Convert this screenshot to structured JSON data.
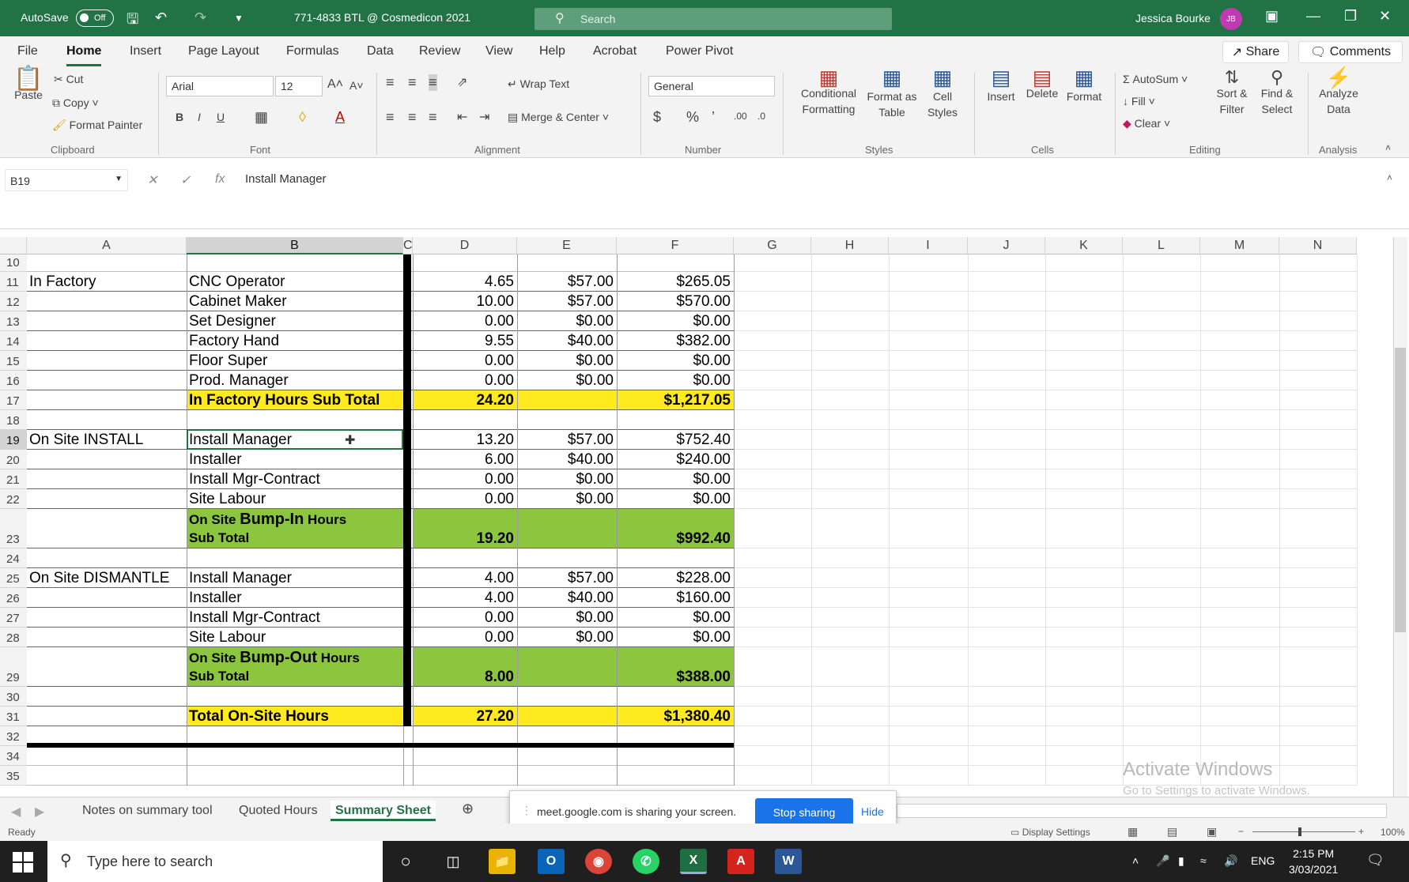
{
  "titlebar": {
    "autosave_label": "AutoSave",
    "autosave_state": "Off",
    "doc_title": "771-4833 BTL @ Cosmedicon 2021",
    "search_placeholder": "Search",
    "user_name": "Jessica Bourke",
    "user_initials": "JB"
  },
  "ribbon_tabs": [
    "File",
    "Home",
    "Insert",
    "Page Layout",
    "Formulas",
    "Data",
    "Review",
    "View",
    "Help",
    "Acrobat",
    "Power Pivot"
  ],
  "share_label": "Share",
  "comments_label": "Comments",
  "ribbon": {
    "clipboard": {
      "paste": "Paste",
      "cut": "Cut",
      "copy": "Copy",
      "format_painter": "Format Painter",
      "label": "Clipboard"
    },
    "font": {
      "family": "Arial",
      "size": "12",
      "label": "Font"
    },
    "alignment": {
      "wrap_text": "Wrap Text",
      "merge_center": "Merge & Center",
      "label": "Alignment"
    },
    "number": {
      "format": "General",
      "label": "Number"
    },
    "styles": {
      "conditional": "Conditional",
      "conditional2": "Formatting",
      "format_as": "Format as",
      "format_as2": "Table",
      "cell": "Cell",
      "cell2": "Styles",
      "label": "Styles"
    },
    "cells": {
      "insert": "Insert",
      "delete": "Delete",
      "format": "Format",
      "label": "Cells"
    },
    "editing": {
      "autosum": "AutoSum",
      "fill": "Fill",
      "clear": "Clear",
      "sort": "Sort &",
      "sort2": "Filter",
      "find": "Find &",
      "find2": "Select",
      "label": "Editing"
    },
    "analysis": {
      "analyze": "Analyze",
      "analyze2": "Data",
      "label": "Analysis"
    }
  },
  "formula_bar": {
    "name_box": "B19",
    "formula": "Install Manager"
  },
  "columns": [
    "A",
    "B",
    "C",
    "D",
    "E",
    "F",
    "G",
    "H",
    "I",
    "J",
    "K",
    "L",
    "M",
    "N"
  ],
  "rows": [
    {
      "num": "10",
      "a": "",
      "b": "",
      "d": "",
      "e": "",
      "f": ""
    },
    {
      "num": "11",
      "a": "In Factory",
      "b": "CNC Operator",
      "d": "4.65",
      "e": "$57.00",
      "f": "$265.05"
    },
    {
      "num": "12",
      "a": "",
      "b": "Cabinet Maker",
      "d": "10.00",
      "e": "$57.00",
      "f": "$570.00"
    },
    {
      "num": "13",
      "a": "",
      "b": "Set Designer",
      "d": "0.00",
      "e": "$0.00",
      "f": "$0.00"
    },
    {
      "num": "14",
      "a": "",
      "b": "Factory Hand",
      "d": "9.55",
      "e": "$40.00",
      "f": "$382.00"
    },
    {
      "num": "15",
      "a": "",
      "b": "Floor Super",
      "d": "0.00",
      "e": "$0.00",
      "f": "$0.00"
    },
    {
      "num": "16",
      "a": "",
      "b": "Prod. Manager",
      "d": "0.00",
      "e": "$0.00",
      "f": "$0.00"
    },
    {
      "num": "17",
      "a": "",
      "b": "In Factory Hours Sub Total",
      "d": "24.20",
      "e": "",
      "f": "$1,217.05"
    },
    {
      "num": "18",
      "a": "",
      "b": "",
      "d": "",
      "e": "",
      "f": ""
    },
    {
      "num": "19",
      "a": "On Site INSTALL",
      "b": "Install Manager",
      "d": "13.20",
      "e": "$57.00",
      "f": "$752.40"
    },
    {
      "num": "20",
      "a": "",
      "b": "Installer",
      "d": "6.00",
      "e": "$40.00",
      "f": "$240.00"
    },
    {
      "num": "21",
      "a": "",
      "b": "Install Mgr-Contract",
      "d": "0.00",
      "e": "$0.00",
      "f": "$0.00"
    },
    {
      "num": "22",
      "a": "",
      "b": "Site Labour",
      "d": "0.00",
      "e": "$0.00",
      "f": "$0.00"
    },
    {
      "num": "23",
      "a": "",
      "b1": "On Site ",
      "b2": "Bump-In",
      "b3": " Hours",
      "b4": "Sub Total",
      "d": "19.20",
      "e": "",
      "f": "$992.40"
    },
    {
      "num": "24",
      "a": "",
      "b": "",
      "d": "",
      "e": "",
      "f": ""
    },
    {
      "num": "25",
      "a": "On Site DISMANTLE",
      "b": "Install Manager",
      "d": "4.00",
      "e": "$57.00",
      "f": "$228.00"
    },
    {
      "num": "26",
      "a": "",
      "b": "Installer",
      "d": "4.00",
      "e": "$40.00",
      "f": "$160.00"
    },
    {
      "num": "27",
      "a": "",
      "b": "Install Mgr-Contract",
      "d": "0.00",
      "e": "$0.00",
      "f": "$0.00"
    },
    {
      "num": "28",
      "a": "",
      "b": "Site Labour",
      "d": "0.00",
      "e": "$0.00",
      "f": "$0.00"
    },
    {
      "num": "29",
      "a": "",
      "b1": "On Site ",
      "b2": "Bump-Out",
      "b3": " Hours",
      "b4": "Sub Total",
      "d": "8.00",
      "e": "",
      "f": "$388.00"
    },
    {
      "num": "30",
      "a": "",
      "b": "",
      "d": "",
      "e": "",
      "f": ""
    },
    {
      "num": "31",
      "a": "",
      "b": "Total On-Site Hours",
      "d": "27.20",
      "e": "",
      "f": "$1,380.40"
    },
    {
      "num": "32",
      "a": "",
      "b": "",
      "d": "",
      "e": "",
      "f": ""
    },
    {
      "num": "34",
      "a": "",
      "b": "",
      "d": "",
      "e": "",
      "f": ""
    },
    {
      "num": "35",
      "a": "",
      "b": "",
      "d": "",
      "e": "",
      "f": ""
    }
  ],
  "sheet_tabs": [
    "Notes on summary tool",
    "Quoted Hours",
    "Summary Sheet"
  ],
  "screen_share": {
    "message": "meet.google.com is sharing your screen.",
    "stop": "Stop sharing",
    "hide": "Hide"
  },
  "status": {
    "ready": "Ready",
    "display_settings": "Display Settings",
    "zoom": "100%"
  },
  "watermark": {
    "line1": "Activate Windows",
    "line2": "Go to Settings to activate Windows."
  },
  "taskbar": {
    "search_placeholder": "Type here to search",
    "lang": "ENG",
    "time": "2:15 PM",
    "date": "3/03/2021"
  },
  "colors": {
    "excel_green": "#217346",
    "yellow": "#ffe91f",
    "green_fill": "#8cc63f",
    "stop_btn": "#1a73e8"
  }
}
